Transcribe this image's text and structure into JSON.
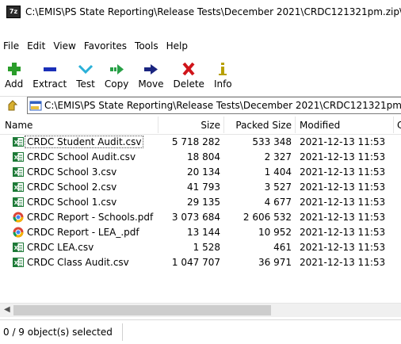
{
  "window": {
    "title": "C:\\EMIS\\PS State Reporting\\Release Tests\\December 2021\\CRDC121321pm.zip\\",
    "app_icon_text": "7z"
  },
  "menu": [
    "File",
    "Edit",
    "View",
    "Favorites",
    "Tools",
    "Help"
  ],
  "toolbar": {
    "add": "Add",
    "extract": "Extract",
    "test": "Test",
    "copy": "Copy",
    "move": "Move",
    "delete": "Delete",
    "info": "Info"
  },
  "address": {
    "path": "C:\\EMIS\\PS State Reporting\\Release Tests\\December 2021\\CRDC121321pm"
  },
  "columns": {
    "name": "Name",
    "size": "Size",
    "packed": "Packed Size",
    "modified": "Modified",
    "extra": "C"
  },
  "files": [
    {
      "name": "CRDC Student Audit.csv",
      "size": "5 718 282",
      "packed": "533 348",
      "modified": "2021-12-13 11:53",
      "type": "csv"
    },
    {
      "name": "CRDC School Audit.csv",
      "size": "18 804",
      "packed": "2 327",
      "modified": "2021-12-13 11:53",
      "type": "csv"
    },
    {
      "name": "CRDC School 3.csv",
      "size": "20 134",
      "packed": "1 404",
      "modified": "2021-12-13 11:53",
      "type": "csv"
    },
    {
      "name": "CRDC School 2.csv",
      "size": "41 793",
      "packed": "3 527",
      "modified": "2021-12-13 11:53",
      "type": "csv"
    },
    {
      "name": "CRDC School 1.csv",
      "size": "29 135",
      "packed": "4 677",
      "modified": "2021-12-13 11:53",
      "type": "csv"
    },
    {
      "name": "CRDC Report - Schools.pdf",
      "size": "3 073 684",
      "packed": "2 606 532",
      "modified": "2021-12-13 11:53",
      "type": "pdf"
    },
    {
      "name": "CRDC Report - LEA_.pdf",
      "size": "13 144",
      "packed": "10 952",
      "modified": "2021-12-13 11:53",
      "type": "pdf"
    },
    {
      "name": "CRDC LEA.csv",
      "size": "1 528",
      "packed": "461",
      "modified": "2021-12-13 11:53",
      "type": "csv"
    },
    {
      "name": "CRDC Class Audit.csv",
      "size": "1 047 707",
      "packed": "36 971",
      "modified": "2021-12-13 11:53",
      "type": "csv"
    }
  ],
  "status": {
    "selection": "0 / 9 object(s) selected"
  },
  "colors": {
    "add": "#2a9d2a",
    "extract": "#1a2fb8",
    "test": "#2ab0d8",
    "copy": "#27a046",
    "move": "#1a2580",
    "delete": "#d0141a",
    "info": "#b8a000"
  }
}
